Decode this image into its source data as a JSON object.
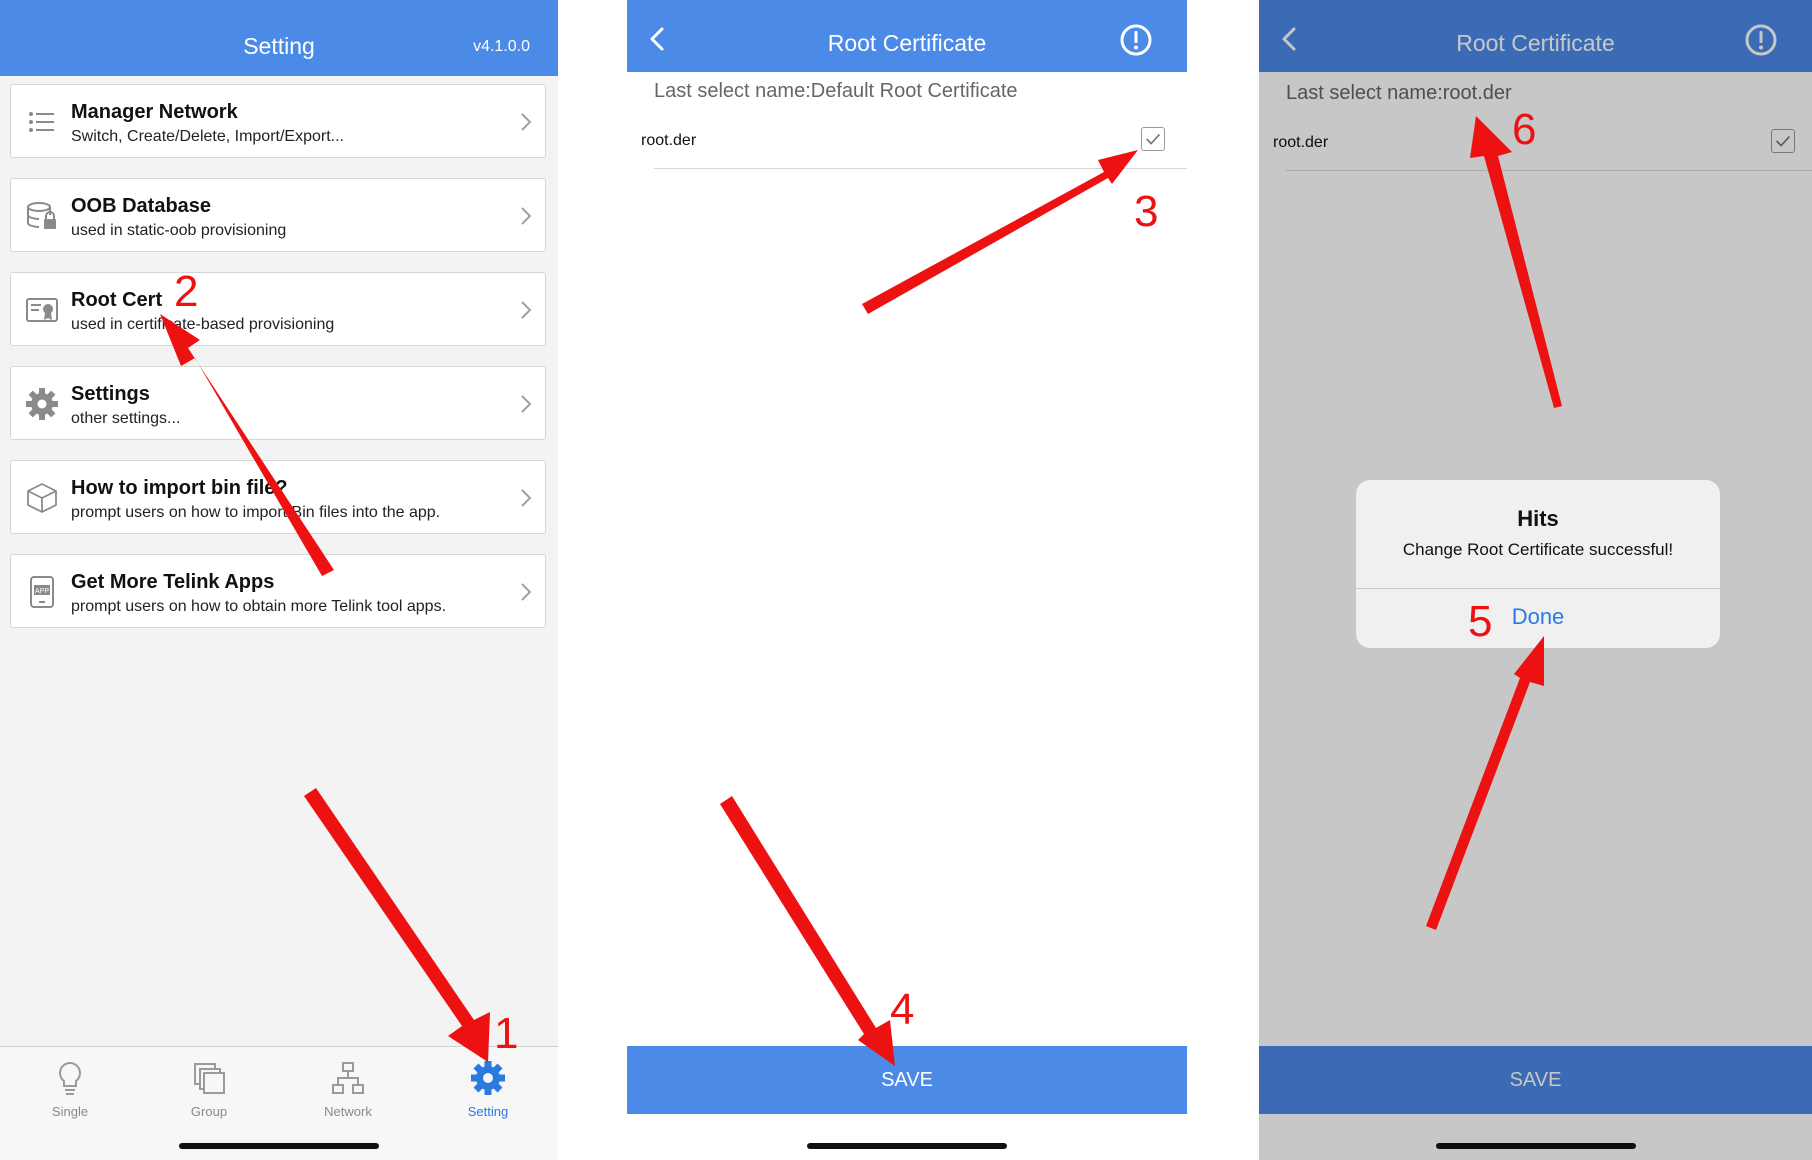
{
  "setting_screen": {
    "title": "Setting",
    "version": "v4.1.0.0",
    "items": [
      {
        "title": "Manager Network",
        "subtitle": "Switch, Create/Delete, Import/Export..."
      },
      {
        "title": "OOB Database",
        "subtitle": "used in static-oob provisioning"
      },
      {
        "title": "Root Cert",
        "subtitle": "used in certificate-based provisioning"
      },
      {
        "title": "Settings",
        "subtitle": "other settings..."
      },
      {
        "title": "How to import bin file?",
        "subtitle": "prompt users on how to import Bin files into the app."
      },
      {
        "title": "Get More Telink Apps",
        "subtitle": "prompt users on how to obtain more Telink tool apps."
      }
    ],
    "tabs": [
      {
        "label": "Single",
        "icon": "lightbulb-icon"
      },
      {
        "label": "Group",
        "icon": "group-icon"
      },
      {
        "label": "Network",
        "icon": "network-icon"
      },
      {
        "label": "Setting",
        "icon": "gear-icon",
        "active": true
      }
    ]
  },
  "root_cert_screen": {
    "title": "Root Certificate",
    "last_select": "Last select name:Default Root Certificate",
    "file_name": "root.der",
    "save_label": "SAVE"
  },
  "root_cert_result_screen": {
    "title": "Root Certificate",
    "last_select": "Last select name:root.der",
    "file_name": "root.der",
    "save_label": "SAVE",
    "alert": {
      "title": "Hits",
      "message": "Change Root Certificate successful!",
      "button": "Done"
    }
  },
  "annotations": {
    "steps": [
      "1",
      "2",
      "3",
      "4",
      "5",
      "6"
    ],
    "color": "#ee1111"
  },
  "colors": {
    "accent": "#4c8ae8",
    "link": "#2a7ae2"
  }
}
